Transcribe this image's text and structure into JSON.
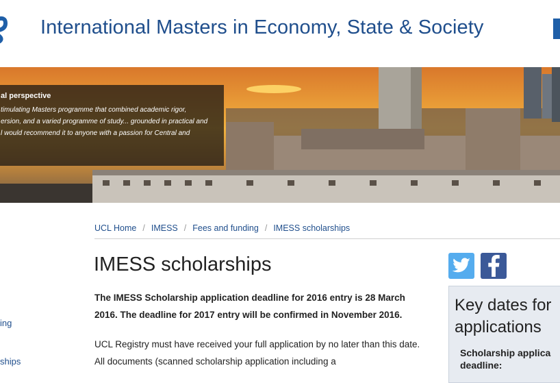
{
  "header": {
    "title": "International Masters in Economy, State & Society",
    "logo_icon": "imess-logo-icon",
    "accent": "#1f4e8c"
  },
  "banner": {
    "quote_title": "al perspective",
    "quote_lines": [
      "timulating Masters programme that combined academic rigor,",
      "ersion, and a varied programme of study... grounded in practical and",
      "l would recommend it to anyone with a passion for Central and"
    ]
  },
  "breadcrumb": {
    "items": [
      "UCL Home",
      "IMESS",
      "Fees and funding",
      "IMESS scholarships"
    ],
    "separator": "/"
  },
  "leftnav": {
    "items": [
      "ing",
      "ships"
    ]
  },
  "main": {
    "title": "IMESS scholarships",
    "lead": "The IMESS Scholarship application deadline for 2016 entry is 28 March 2016. The deadline for 2017 entry will be confirmed in November 2016.",
    "body": "UCL Registry must have received your full application by no later than this date. All documents (scanned scholarship application including a"
  },
  "social": {
    "twitter_icon": "twitter-icon",
    "facebook_icon": "facebook-icon"
  },
  "keydates": {
    "title": "Key dates for applications",
    "label": "Scholarship applica deadline:"
  }
}
